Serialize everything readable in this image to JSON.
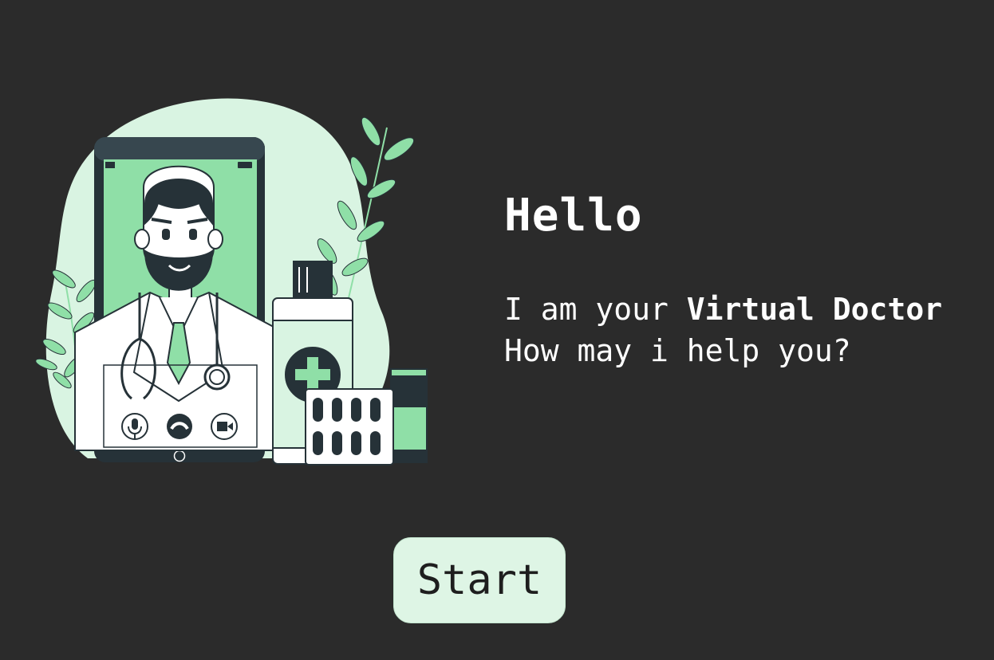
{
  "greeting": {
    "title": "Hello",
    "intro_prefix": "I am your ",
    "intro_highlight": "Virtual Doctor",
    "question": "How may i help you?"
  },
  "actions": {
    "start_label": "Start"
  },
  "illustration": {
    "subject": "doctor-video-call-illustration",
    "colors": {
      "accent": "#8fdfa7",
      "light": "#d9f4e2",
      "dark": "#263238",
      "background": "#2b2b2b"
    }
  }
}
